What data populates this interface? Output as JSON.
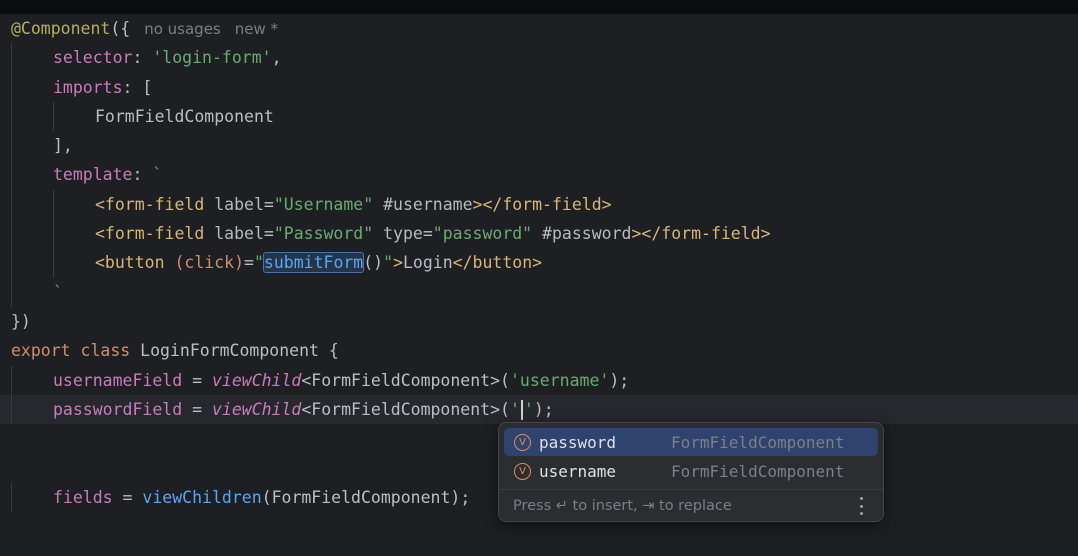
{
  "editor": {
    "lines": [
      {
        "id": "l1",
        "segments": [
          {
            "t": "@Component",
            "c": "ann"
          },
          {
            "t": "({",
            "c": "plain"
          }
        ],
        "hints": [
          "no usages",
          "new *"
        ]
      },
      {
        "id": "l2",
        "indent": 1,
        "segments": [
          {
            "t": "selector",
            "c": "prop"
          },
          {
            "t": ": ",
            "c": "plain"
          },
          {
            "t": "'login-form'",
            "c": "str"
          },
          {
            "t": ",",
            "c": "plain"
          }
        ]
      },
      {
        "id": "l3",
        "indent": 1,
        "segments": [
          {
            "t": "imports",
            "c": "prop"
          },
          {
            "t": ": [",
            "c": "plain"
          }
        ]
      },
      {
        "id": "l4",
        "indent": 2,
        "segments": [
          {
            "t": "FormFieldComponent",
            "c": "plain"
          }
        ]
      },
      {
        "id": "l5",
        "indent": 1,
        "segments": [
          {
            "t": "],",
            "c": "plain"
          }
        ]
      },
      {
        "id": "l6",
        "indent": 1,
        "segments": [
          {
            "t": "template",
            "c": "prop"
          },
          {
            "t": ": ",
            "c": "plain"
          },
          {
            "t": "`",
            "c": "str"
          }
        ]
      },
      {
        "id": "l7",
        "indent": 2,
        "segments": [
          {
            "t": "<form-field ",
            "c": "tag"
          },
          {
            "t": "label",
            "c": "attr"
          },
          {
            "t": "=",
            "c": "plain"
          },
          {
            "t": "\"Username\"",
            "c": "str"
          },
          {
            "t": " #username",
            "c": "attr"
          },
          {
            "t": "></form-field>",
            "c": "tag"
          }
        ]
      },
      {
        "id": "l8",
        "indent": 2,
        "segments": [
          {
            "t": "<form-field ",
            "c": "tag"
          },
          {
            "t": "label",
            "c": "attr"
          },
          {
            "t": "=",
            "c": "plain"
          },
          {
            "t": "\"Password\"",
            "c": "str"
          },
          {
            "t": " type",
            "c": "attr"
          },
          {
            "t": "=",
            "c": "plain"
          },
          {
            "t": "\"password\"",
            "c": "str"
          },
          {
            "t": " #password",
            "c": "attr"
          },
          {
            "t": "></form-field>",
            "c": "tag"
          }
        ]
      },
      {
        "id": "l9",
        "indent": 2,
        "segments": [
          {
            "t": "<button ",
            "c": "tag"
          },
          {
            "t": "(click)",
            "c": "kw"
          },
          {
            "t": "=",
            "c": "plain"
          },
          {
            "t": "\"",
            "c": "str"
          },
          {
            "t": "submitForm",
            "c": "fn",
            "box": true
          },
          {
            "t": "()",
            "c": "plain"
          },
          {
            "t": "\"",
            "c": "str"
          },
          {
            "t": ">",
            "c": "tag"
          },
          {
            "t": "Login",
            "c": "plain"
          },
          {
            "t": "</button>",
            "c": "tag"
          }
        ]
      },
      {
        "id": "l10",
        "indent": 1,
        "segments": [
          {
            "t": "`",
            "c": "str"
          }
        ]
      },
      {
        "id": "l11",
        "segments": [
          {
            "t": "})",
            "c": "plain"
          }
        ]
      },
      {
        "id": "l12",
        "segments": [
          {
            "t": "export ",
            "c": "kw"
          },
          {
            "t": "class ",
            "c": "kw"
          },
          {
            "t": "LoginFormComponent {",
            "c": "plain"
          }
        ]
      },
      {
        "id": "l13",
        "indent": 1,
        "segments": [
          {
            "t": "usernameField",
            "c": "field"
          },
          {
            "t": " = ",
            "c": "plain"
          },
          {
            "t": "viewChild",
            "c": "italic-fn"
          },
          {
            "t": "<FormFieldComponent>(",
            "c": "plain"
          },
          {
            "t": "'username'",
            "c": "str"
          },
          {
            "t": ");",
            "c": "plain"
          }
        ]
      },
      {
        "id": "l14",
        "indent": 1,
        "current": true,
        "segments": [
          {
            "t": "passwordField",
            "c": "field"
          },
          {
            "t": " = ",
            "c": "plain"
          },
          {
            "t": "viewChild",
            "c": "italic-fn"
          },
          {
            "t": "<FormFieldComponent>(",
            "c": "plain"
          },
          {
            "t": "'",
            "c": "str"
          },
          {
            "caret": true
          },
          {
            "t": "'",
            "c": "str"
          },
          {
            "t": ");",
            "c": "plain"
          }
        ]
      },
      {
        "id": "l15",
        "segments": []
      },
      {
        "id": "l16",
        "segments": []
      },
      {
        "id": "l17",
        "indent": 1,
        "segments": [
          {
            "t": "fields",
            "c": "field"
          },
          {
            "t": " = ",
            "c": "plain"
          },
          {
            "t": "viewChildren",
            "c": "fn"
          },
          {
            "t": "(FormFieldComponent);",
            "c": "plain"
          }
        ]
      }
    ]
  },
  "completion": {
    "items": [
      {
        "icon": "V",
        "name": "password",
        "type": "FormFieldComponent",
        "selected": true
      },
      {
        "icon": "V",
        "name": "username",
        "type": "FormFieldComponent",
        "selected": false
      }
    ],
    "footer": "Press ↵ to insert, ⇥ to replace"
  },
  "colors": {
    "background": "#1e1f22",
    "current_line": "#26282e",
    "popup_selected": "#2e436e",
    "string": "#6aab73",
    "keyword": "#cf8e6d",
    "annotation": "#b3ae60",
    "property": "#c77dbb"
  },
  "icons": [
    "variable-icon",
    "more-options-icon",
    "text-caret"
  ]
}
